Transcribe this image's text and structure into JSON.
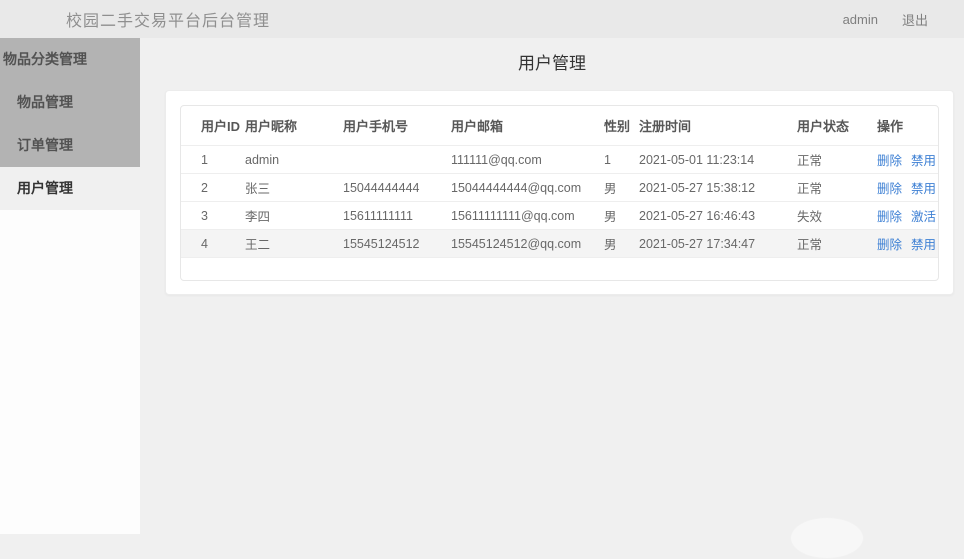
{
  "header": {
    "title": "校园二手交易平台后台管理",
    "username": "admin",
    "logout_label": "退出"
  },
  "sidebar": {
    "items": [
      {
        "label": "物品分类管理"
      },
      {
        "label": "物品管理"
      },
      {
        "label": "订单管理"
      },
      {
        "label": "用户管理"
      }
    ],
    "active_index": 3
  },
  "main": {
    "page_title": "用户管理",
    "table": {
      "columns": [
        "用户ID",
        "用户昵称",
        "用户手机号",
        "用户邮箱",
        "性别",
        "注册时间",
        "用户状态",
        "操作"
      ],
      "rows": [
        {
          "id": "1",
          "nickname": "admin",
          "phone": "",
          "email": "111111@qq.com",
          "gender": "1",
          "registered_at": "2021-05-01 11:23:14",
          "status": "正常",
          "actions": [
            "删除",
            "禁用"
          ]
        },
        {
          "id": "2",
          "nickname": "张三",
          "phone": "15044444444",
          "email": "15044444444@qq.com",
          "gender": "男",
          "registered_at": "2021-05-27 15:38:12",
          "status": "正常",
          "actions": [
            "删除",
            "禁用"
          ]
        },
        {
          "id": "3",
          "nickname": "李四",
          "phone": "15611111111",
          "email": "15611111111@qq.com",
          "gender": "男",
          "registered_at": "2021-05-27 16:46:43",
          "status": "失效",
          "actions": [
            "删除",
            "激活"
          ]
        },
        {
          "id": "4",
          "nickname": "王二",
          "phone": "15545124512",
          "email": "15545124512@qq.com",
          "gender": "男",
          "registered_at": "2021-05-27 17:34:47",
          "status": "正常",
          "actions": [
            "删除",
            "禁用"
          ]
        }
      ]
    }
  },
  "colors": {
    "page_bg": "#f0f0f0",
    "header_bg": "#e9e9e9",
    "sidebar_gray": "#b3b3b3",
    "link_blue": "#3e80d4"
  }
}
